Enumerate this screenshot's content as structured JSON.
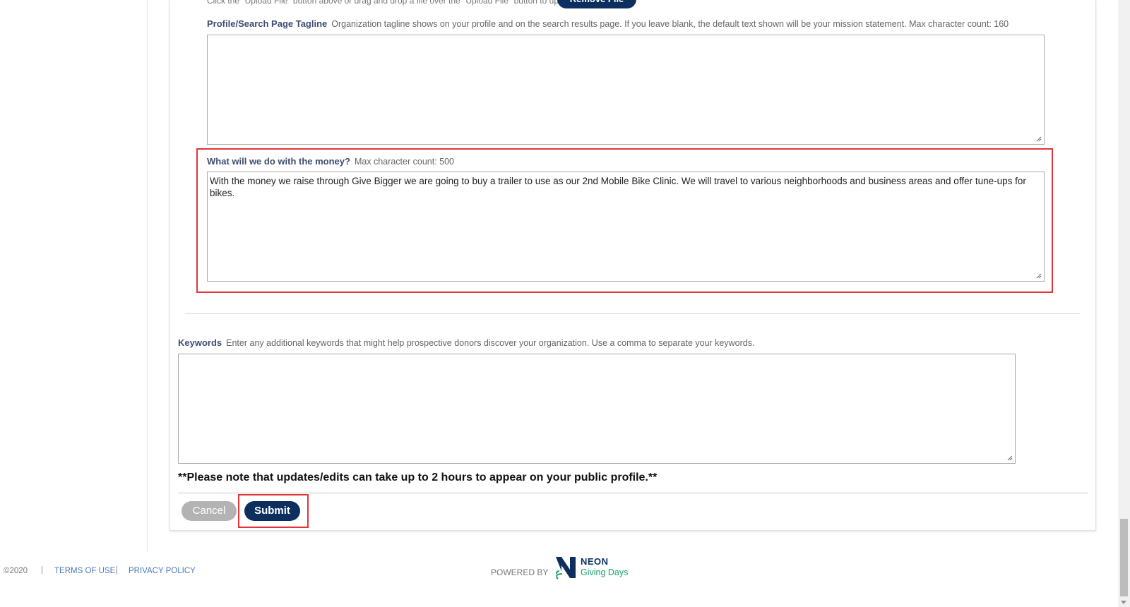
{
  "upload": {
    "hint_text": "Click the \"Upload File\" button above or drag and drop a file over the \"Upload File\" button to upload.",
    "remove_label": "Remove File"
  },
  "tagline": {
    "label": "Profile/Search Page Tagline",
    "help": "Organization tagline shows on your profile and on the search results page. If you leave blank, the default text shown will be your mission statement. Max character count: 160",
    "value": ""
  },
  "money": {
    "label": "What will we do with the money?",
    "help": "Max character count: 500",
    "value": "With the money we raise through Give Bigger we are going to buy a trailer to use as our 2nd Mobile Bike Clinic. We will travel to various neighborhoods and business areas and offer tune-ups for bikes."
  },
  "keywords": {
    "label": "Keywords",
    "help": "Enter any additional keywords that might help prospective donors discover your organization. Use a comma to separate your keywords.",
    "value": ""
  },
  "notice": "**Please note that updates/edits can take up to 2 hours to appear on your public profile.**",
  "actions": {
    "cancel_label": "Cancel",
    "submit_label": "Submit"
  },
  "footer": {
    "copyright": "©2020",
    "separator": "|",
    "terms": "TERMS OF USE",
    "privacy": "PRIVACY POLICY",
    "powered_by": "POWERED BY",
    "brand_name": "NEON",
    "brand_sub": "Giving Days"
  },
  "colors": {
    "primary": "#0c2f5f",
    "highlight": "#e0353b",
    "label": "#3d4e72",
    "link": "#4a7ab8",
    "brand_green": "#17a36b"
  }
}
